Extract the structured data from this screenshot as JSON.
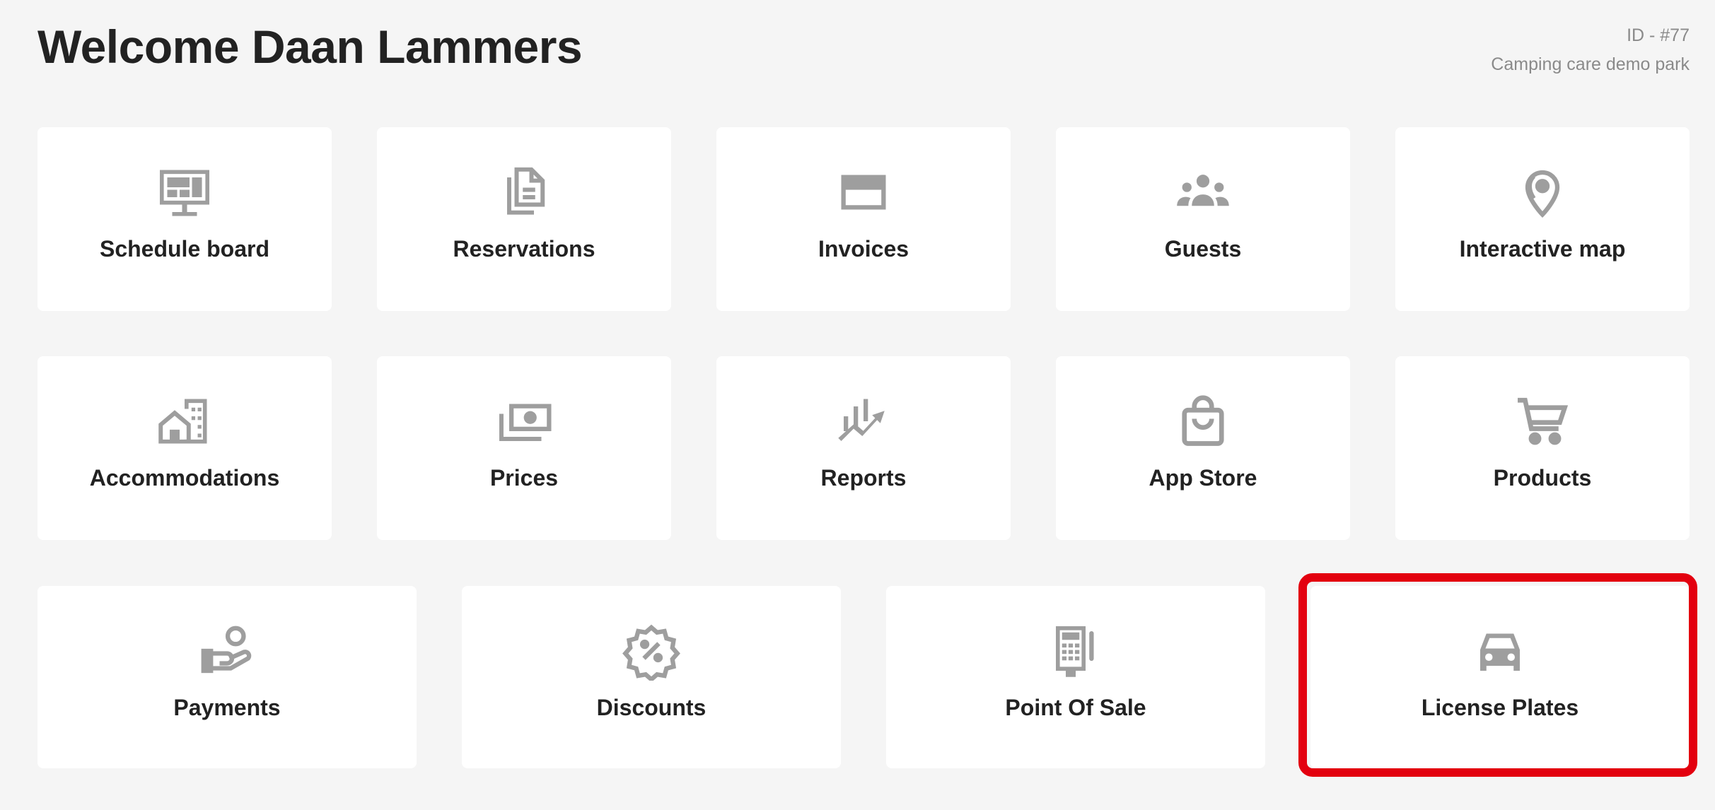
{
  "header": {
    "title": "Welcome Daan Lammers",
    "id_text": "ID - #77",
    "park_name": "Camping care demo park"
  },
  "tiles": [
    {
      "label": "Schedule board",
      "icon": "monitor-icon"
    },
    {
      "label": "Reservations",
      "icon": "documents-icon"
    },
    {
      "label": "Invoices",
      "icon": "credit-card-icon"
    },
    {
      "label": "Guests",
      "icon": "people-group-icon"
    },
    {
      "label": "Interactive map",
      "icon": "map-pin-icon"
    },
    {
      "label": "Accommodations",
      "icon": "buildings-icon"
    },
    {
      "label": "Prices",
      "icon": "money-icon"
    },
    {
      "label": "Reports",
      "icon": "chart-trend-icon"
    },
    {
      "label": "App Store",
      "icon": "shopping-bag-icon"
    },
    {
      "label": "Products",
      "icon": "shopping-cart-icon"
    },
    {
      "label": "Payments",
      "icon": "hand-coin-icon"
    },
    {
      "label": "Discounts",
      "icon": "discount-badge-icon"
    },
    {
      "label": "Point Of Sale",
      "icon": "pos-terminal-icon"
    },
    {
      "label": "License Plates",
      "icon": "car-icon"
    }
  ],
  "colors": {
    "background": "#f5f5f5",
    "icon": "#9e9e9e",
    "highlight": "#e3000f"
  }
}
